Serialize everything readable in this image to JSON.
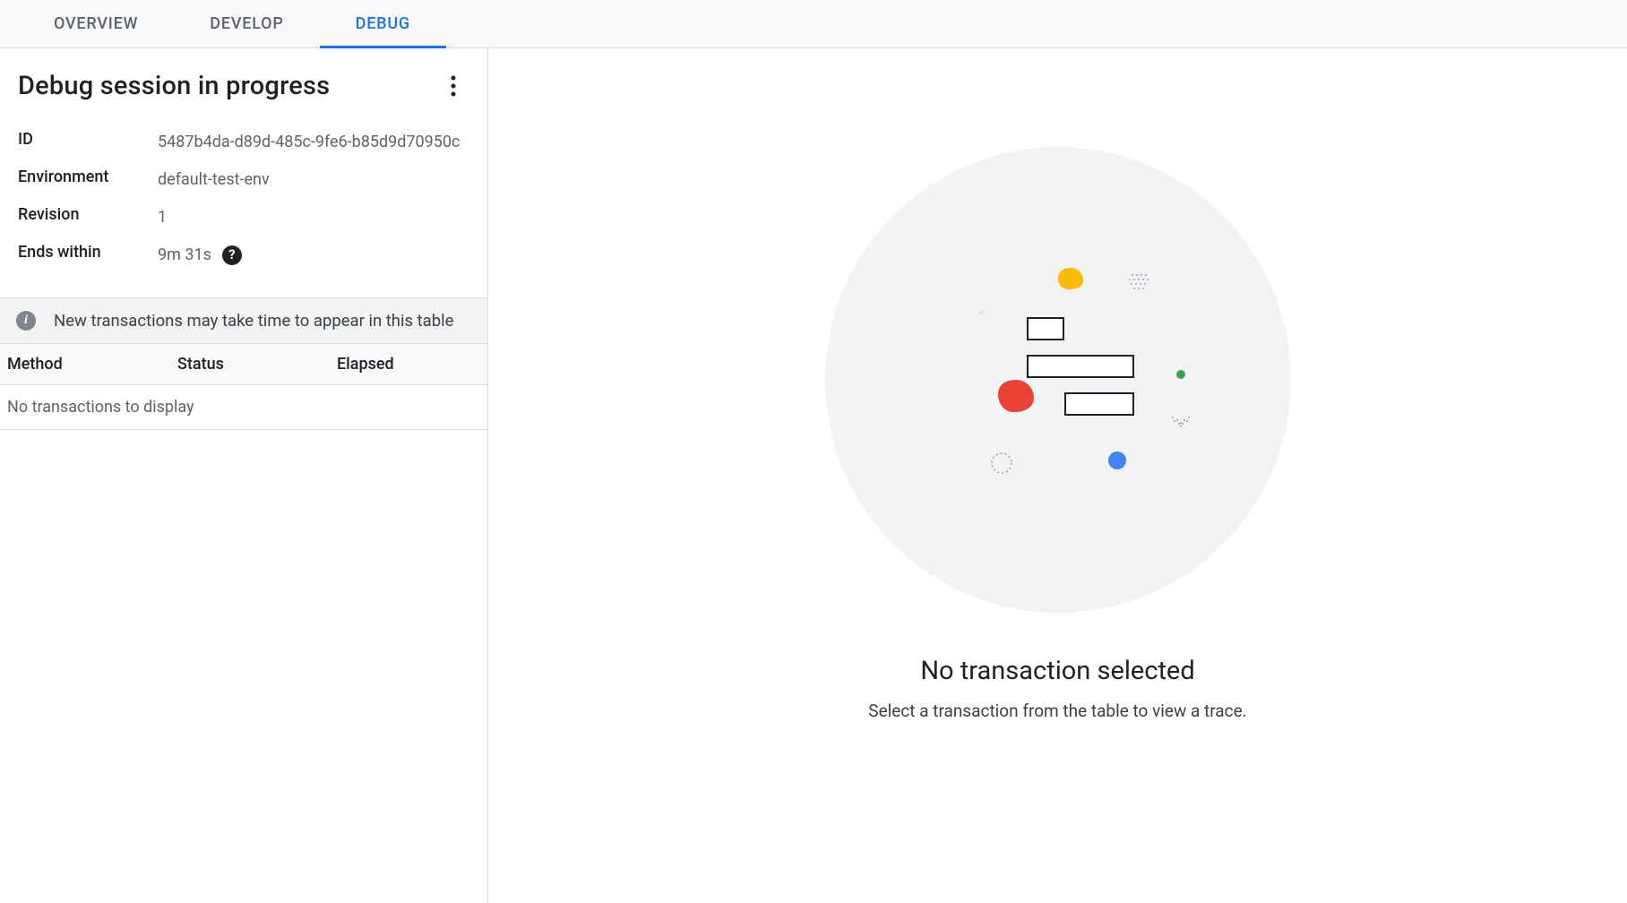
{
  "tabs": {
    "overview": "OVERVIEW",
    "develop": "DEVELOP",
    "debug": "DEBUG"
  },
  "session": {
    "title": "Debug session in progress",
    "id_label": "ID",
    "id_value": "5487b4da-d89d-485c-9fe6-b85d9d70950c",
    "env_label": "Environment",
    "env_value": "default-test-env",
    "rev_label": "Revision",
    "rev_value": "1",
    "ends_label": "Ends within",
    "ends_value": "9m 31s"
  },
  "info_banner": "New transactions may take time to appear in this table",
  "table": {
    "method": "Method",
    "status": "Status",
    "elapsed": "Elapsed",
    "empty": "No transactions to display"
  },
  "empty_state": {
    "title": "No transaction selected",
    "subtitle": "Select a transaction from the table to view a trace."
  },
  "colors": {
    "yellow": "#fbbc04",
    "red": "#ea4335",
    "blue": "#4285f4",
    "green": "#34a853"
  }
}
